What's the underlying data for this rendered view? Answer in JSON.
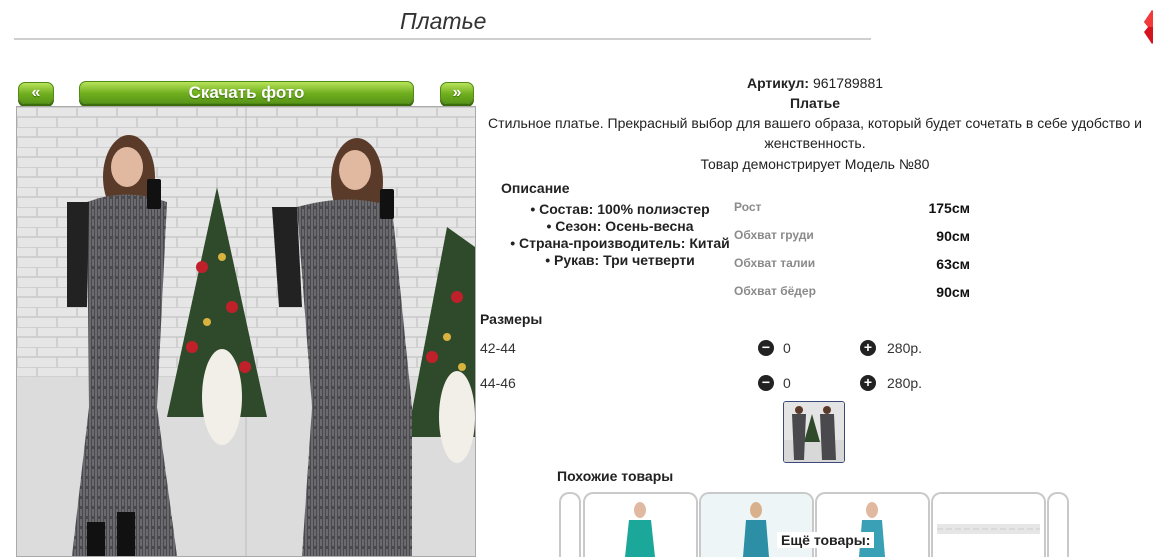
{
  "page": {
    "title": "Платье"
  },
  "gallery": {
    "prev_label": "«",
    "next_label": "»",
    "download_label": "Скачать фото"
  },
  "product": {
    "article_label": "Артикул:",
    "article_value": "961789881",
    "name": "Платье",
    "description_line1": "Стильное платье. Прекрасный выбор для вашего образа, который будет сочетать в себе удобство и",
    "description_line2": "женственность.",
    "model_note": "Товар демонстрирует Модель №80"
  },
  "description": {
    "heading": "Описание",
    "props": [
      "Состав: 100% полиэстер",
      "Сезон: Осень-весна",
      "Страна-производитель: Китай",
      "Рукав: Три четверти"
    ]
  },
  "measurements": [
    {
      "label": "Рост",
      "value": "175см"
    },
    {
      "label": "Обхват груди",
      "value": "90см"
    },
    {
      "label": "Обхват талии",
      "value": "63см"
    },
    {
      "label": "Обхват бёдер",
      "value": "90см"
    }
  ],
  "sizes": {
    "heading": "Размеры",
    "rows": [
      {
        "size": "42-44",
        "qty": "0",
        "price": "280р."
      },
      {
        "size": "44-46",
        "qty": "0",
        "price": "280р."
      }
    ],
    "minus_icon": "−",
    "plus_icon": "+"
  },
  "similar": {
    "heading": "Похожие товары",
    "more_label": "Ещё товары:"
  },
  "colors": {
    "accent_green": "#6fae1e",
    "red_icon": "#d4141c"
  }
}
